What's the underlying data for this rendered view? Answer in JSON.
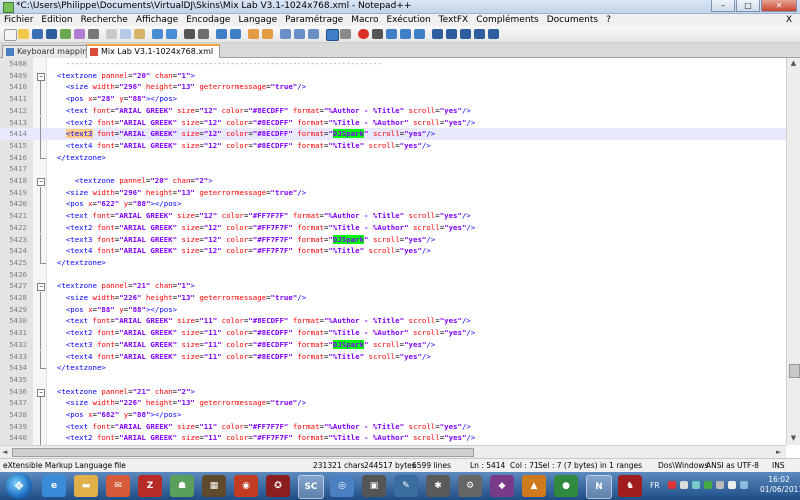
{
  "window": {
    "title": "*C:\\Users\\Philippe\\Documents\\VirtualDJ\\Skins\\Mix Lab V3.1-1024x768.xml - Notepad++",
    "minimize": "–",
    "maximize": "□",
    "close": "✕"
  },
  "menu": {
    "items": [
      "Fichier",
      "Edition",
      "Recherche",
      "Affichage",
      "Encodage",
      "Langage",
      "Paramétrage",
      "Macro",
      "Exécution",
      "TextFX",
      "Compléments",
      "Documents",
      "?"
    ],
    "close_doc": "X"
  },
  "tabs": [
    {
      "label": "Keyboard mapping.xml",
      "active": false
    },
    {
      "label": "Mix Lab V3.1-1024x768.xml",
      "active": true
    }
  ],
  "editor": {
    "lines": [
      {
        "n": "5408",
        "code": "    -----------------------------------------------------------------------"
      },
      {
        "n": "5409",
        "code": "  <textzone pannel=\"20\" chan=\"1\">"
      },
      {
        "n": "5410",
        "code": "    <size width=\"296\" height=\"13\" geterrormessage=\"true\"/>"
      },
      {
        "n": "5411",
        "code": "    <pos x=\"28\" y=\"88\"></pos>"
      },
      {
        "n": "5412",
        "code": "    <text font=\"ARIAL GREEK\" size=\"12\" color=\"#8ECDFF\" format=\"%Author - %Title\" scroll=\"yes\"/>"
      },
      {
        "n": "5413",
        "code": "    <text2 font=\"ARIAL GREEK\" size=\"12\" color=\"#8ECDFF\" format=\"%Title - %Author\" scroll=\"yes\"/>"
      },
      {
        "n": "5414",
        "code": "    <text3 font=\"ARIAL GREEK\" size=\"12\" color=\"#8ECDFF\" format=\"DJSpark\" scroll=\"yes\"/>"
      },
      {
        "n": "5415",
        "code": "    <text4 font=\"ARIAL GREEK\" size=\"12\" color=\"#8ECDFF\" format=\"%Title\" scroll=\"yes\"/>"
      },
      {
        "n": "5416",
        "code": "  </textzone>"
      },
      {
        "n": "5417",
        "code": ""
      },
      {
        "n": "5418",
        "code": "      <textzone pannel=\"20\" chan=\"2\">"
      },
      {
        "n": "5419",
        "code": "    <size width=\"296\" height=\"13\" geterrormessage=\"true\"/>"
      },
      {
        "n": "5420",
        "code": "    <pos x=\"622\" y=\"88\"></pos>"
      },
      {
        "n": "5421",
        "code": "    <text font=\"ARIAL GREEK\" size=\"12\" color=\"#FF7F7F\" format=\"%Author - %Title\" scroll=\"yes\"/>"
      },
      {
        "n": "5422",
        "code": "    <text2 font=\"ARIAL GREEK\" size=\"12\" color=\"#FF7F7F\" format=\"%Title - %Author\" scroll=\"yes\"/>"
      },
      {
        "n": "5423",
        "code": "    <text3 font=\"ARIAL GREEK\" size=\"12\" color=\"#FF7F7F\" format=\"DJSpark\" scroll=\"yes\"/>"
      },
      {
        "n": "5424",
        "code": "    <text4 font=\"ARIAL GREEK\" size=\"12\" color=\"#FF7F7F\" format=\"%Title\" scroll=\"yes\"/>"
      },
      {
        "n": "5425",
        "code": "  </textzone>"
      },
      {
        "n": "5426",
        "code": ""
      },
      {
        "n": "5427",
        "code": "  <textzone pannel=\"21\" chan=\"1\">"
      },
      {
        "n": "5428",
        "code": "    <size width=\"226\" height=\"13\" geterrormessage=\"true\"/>"
      },
      {
        "n": "5429",
        "code": "    <pos x=\"88\" y=\"88\"></pos>"
      },
      {
        "n": "5430",
        "code": "    <text font=\"ARIAL GREEK\" size=\"11\" color=\"#8ECDFF\" format=\"%Author - %Title\" scroll=\"yes\"/>"
      },
      {
        "n": "5431",
        "code": "    <text2 font=\"ARIAL GREEK\" size=\"11\" color=\"#8ECDFF\" format=\"%Title - %Author\" scroll=\"yes\"/>"
      },
      {
        "n": "5432",
        "code": "    <text3 font=\"ARIAL GREEK\" size=\"11\" color=\"#8ECDFF\" format=\"DJSpark\" scroll=\"yes\"/>"
      },
      {
        "n": "5433",
        "code": "    <text4 font=\"ARIAL GREEK\" size=\"11\" color=\"#8ECDFF\" format=\"%Title\" scroll=\"yes\"/>"
      },
      {
        "n": "5434",
        "code": "  </textzone>"
      },
      {
        "n": "5435",
        "code": ""
      },
      {
        "n": "5436",
        "code": "  <textzone pannel=\"21\" chan=\"2\">"
      },
      {
        "n": "5437",
        "code": "    <size width=\"226\" height=\"13\" geterrormessage=\"true\"/>"
      },
      {
        "n": "5438",
        "code": "    <pos x=\"682\" y=\"88\"></pos>"
      },
      {
        "n": "5439",
        "code": "    <text font=\"ARIAL GREEK\" size=\"11\" color=\"#FF7F7F\" format=\"%Author - %Title\" scroll=\"yes\"/>"
      },
      {
        "n": "5440",
        "code": "    <text2 font=\"ARIAL GREEK\" size=\"11\" color=\"#FF7F7F\" format=\"%Title - %Author\" scroll=\"yes\"/>"
      },
      {
        "n": "5441",
        "code": "    <text3 font=\"ARIAL GREEK\" size=\"11\" color=\"#FF7F7F\" format=\"DJSpark\" scroll=\"yes\"/>"
      }
    ],
    "current_line": "5414"
  },
  "statusbar": {
    "filetype": "eXtensible Markup Language file",
    "chars": "231321 chars",
    "bytes": "244517 bytes",
    "lines": "6599 lines",
    "position": "Ln : 5414",
    "col": "Col : 71",
    "selection": "Sel : 7 (7 bytes) in 1 ranges",
    "eol": "Dos\\Windows",
    "encoding": "ANSI as UTF-8",
    "mode": "INS"
  },
  "taskbar": {
    "lang": "FR",
    "time": "16:02",
    "date": "01/06/2011"
  },
  "colors": {
    "tag": "#0000ff",
    "attribute": "#ff0000",
    "value": "#8000ff",
    "highlight": "#00ff00",
    "active_tab_accent": "#f4a040"
  }
}
